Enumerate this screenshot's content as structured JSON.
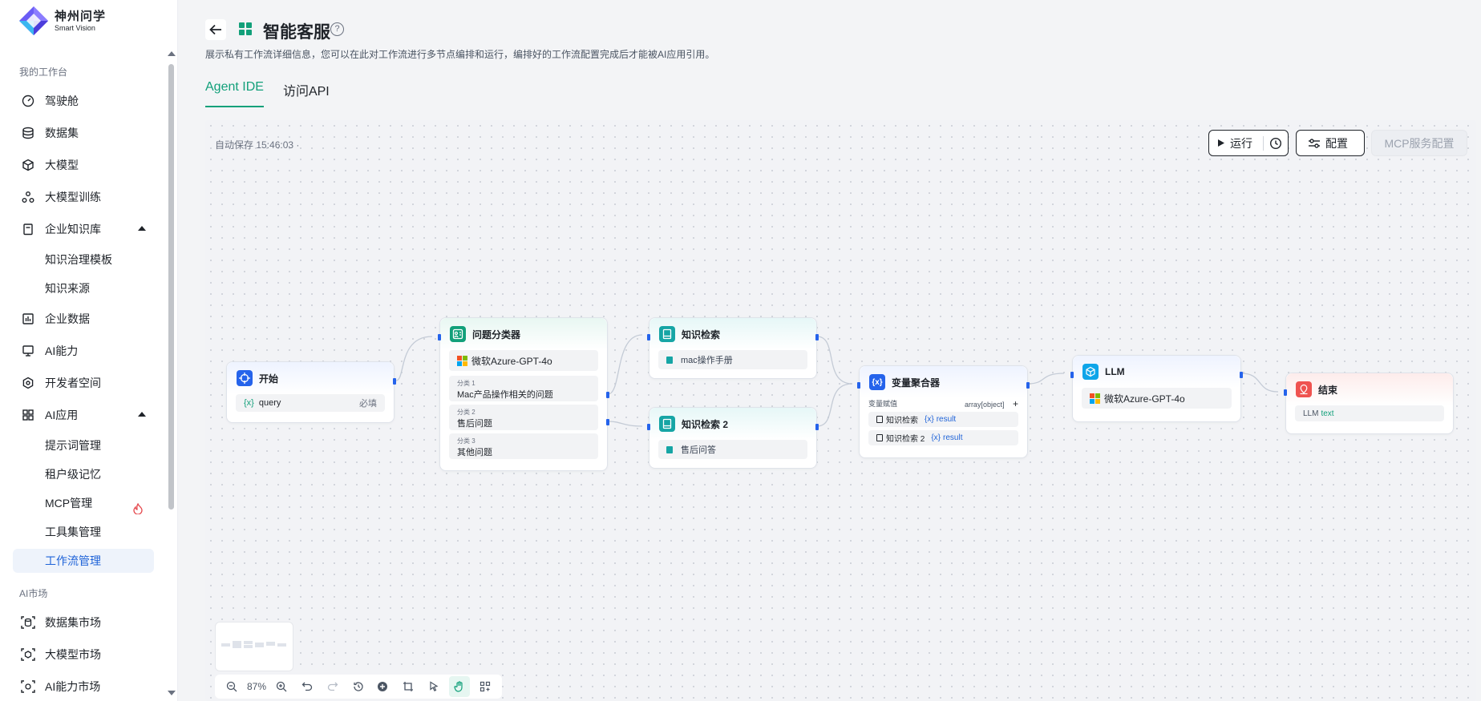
{
  "brand": {
    "name_cn": "神州问学",
    "name_en": "Smart Vision"
  },
  "sidebar": {
    "sections": [
      {
        "title": "我的工作台"
      },
      {
        "title": "AI市场"
      }
    ],
    "items": [
      {
        "label": "驾驶舱",
        "icon": "dashboard-icon"
      },
      {
        "label": "数据集",
        "icon": "database-icon"
      },
      {
        "label": "大模型",
        "icon": "cube-icon"
      },
      {
        "label": "大模型训练",
        "icon": "training-icon"
      },
      {
        "label": "企业知识库",
        "icon": "clipboard-icon"
      },
      {
        "label": "知识治理模板"
      },
      {
        "label": "知识来源"
      },
      {
        "label": "企业数据",
        "icon": "chart-icon"
      },
      {
        "label": "AI能力",
        "icon": "monitor-icon"
      },
      {
        "label": "开发者空间",
        "icon": "hexagon-icon"
      },
      {
        "label": "AI应用",
        "icon": "grid-icon"
      },
      {
        "label": "提示词管理"
      },
      {
        "label": "租户级记忆"
      },
      {
        "label": "MCP管理"
      },
      {
        "label": "工具集管理"
      },
      {
        "label": "工作流管理"
      },
      {
        "label": "数据集市场",
        "icon": "dataset-market-icon"
      },
      {
        "label": "大模型市场",
        "icon": "model-market-icon"
      },
      {
        "label": "AI能力市场",
        "icon": "ability-market-icon"
      }
    ],
    "active": "工作流管理"
  },
  "header": {
    "title": "智能客服",
    "description": "展示私有工作流详细信息，您可以在此对工作流进行多节点编排和运行，编排好的工作流配置完成后才能被AI应用引用。",
    "tabs": [
      "Agent IDE",
      "访问API"
    ],
    "active_tab": "Agent IDE"
  },
  "toolbar": {
    "autosave": "自动保存 15:46:03 ·",
    "run_label": "运行",
    "config_label": "配置",
    "mcp_label": "MCP服务配置"
  },
  "nodes": {
    "start": {
      "title": "开始",
      "var": "query",
      "required": "必填"
    },
    "classifier": {
      "title": "问题分类器",
      "model": "微软Azure-GPT-4o",
      "classes": [
        {
          "label": "分类 1",
          "text": "Mac产品操作相关的问题"
        },
        {
          "label": "分类 2",
          "text": "售后问题"
        },
        {
          "label": "分类 3",
          "text": "其他问题"
        }
      ]
    },
    "kb1": {
      "title": "知识检索",
      "source": "mac操作手册"
    },
    "kb2": {
      "title": "知识检索 2",
      "source": "售后问答"
    },
    "aggregator": {
      "title": "变量聚合器",
      "assign_label": "变量赋值",
      "type": "array[object]",
      "add": "+",
      "items": [
        {
          "node": "知识检索",
          "var": "result"
        },
        {
          "node": "知识检索 2",
          "var": "result"
        }
      ]
    },
    "llm": {
      "title": "LLM",
      "model": "微软Azure-GPT-4o"
    },
    "end": {
      "title": "结束",
      "prefix": "LLM",
      "var": "text"
    }
  },
  "zoom": {
    "level": "87%"
  },
  "colors": {
    "accent": "#12a07a",
    "primary": "#1f63d8",
    "port": "#2563eb"
  }
}
